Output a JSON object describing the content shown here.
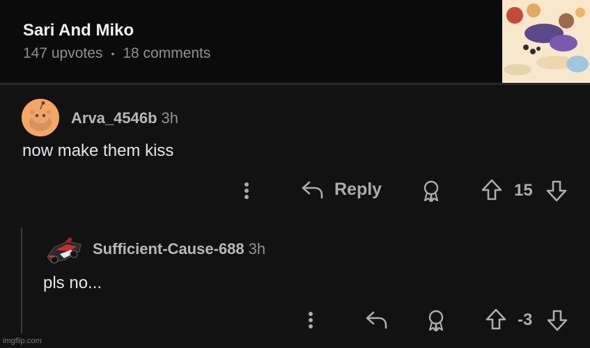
{
  "post": {
    "title": "Sari And Miko",
    "upvotes": "147 upvotes",
    "separator": "•",
    "comments": "18 comments"
  },
  "comments": [
    {
      "username": "Arva_4546b",
      "age": "3h",
      "text": "now make them kiss",
      "reply_label": "Reply",
      "score": "15"
    },
    {
      "username": "Sufficient-Cause-688",
      "age": "3h",
      "text": "pls no...",
      "score": "-3"
    }
  ],
  "watermark": "imgflip.com",
  "icons": [
    "more-vertical-icon",
    "reply-arrow-icon",
    "award-icon",
    "upvote-arrow-icon",
    "downvote-arrow-icon"
  ],
  "colors": {
    "background": "#121212",
    "header_background": "#0b0b0b",
    "avatar_orange": "#f4a765",
    "muted_text": "#8b9196"
  }
}
